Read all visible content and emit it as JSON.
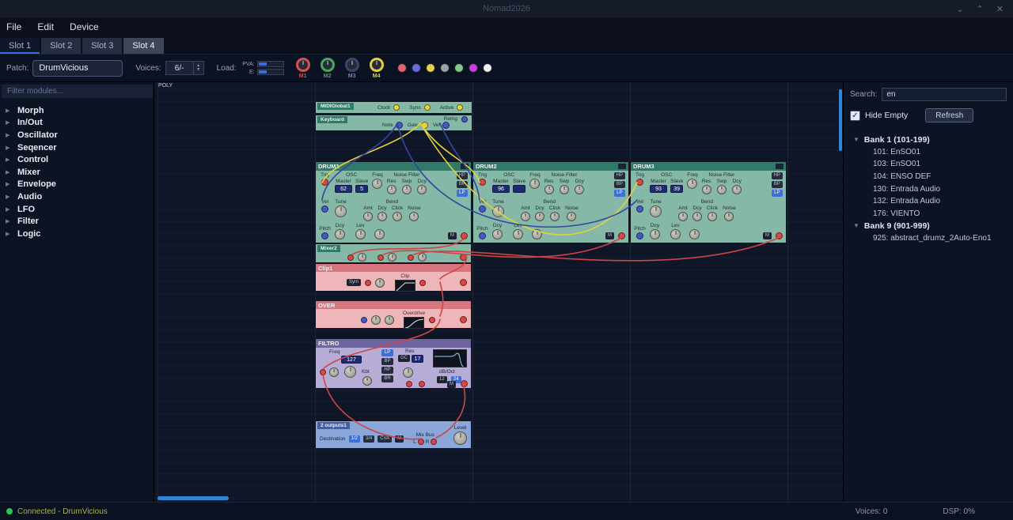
{
  "window": {
    "title": "Nomad2026"
  },
  "menu": {
    "items": [
      "File",
      "Edit",
      "Device"
    ]
  },
  "tabs": {
    "items": [
      "Slot 1",
      "Slot 2",
      "Slot 3",
      "Slot 4"
    ],
    "active": "Slot 4"
  },
  "toolbar": {
    "patch_label": "Patch:",
    "patch_value": "DrumVicious",
    "voices_label": "Voices:",
    "voices_value": "6/-",
    "load_label": "Load:",
    "pva_label": "PVA:",
    "e_label": "E:",
    "morphs": [
      {
        "label": "M1",
        "color": "#d85050"
      },
      {
        "label": "M2",
        "color": "#4aa85c"
      },
      {
        "label": "M3",
        "color": "#3a4670"
      },
      {
        "label": "M4",
        "color": "#e2cf3e"
      }
    ],
    "swatches": [
      "#e0636c",
      "#6a6ade",
      "#e8d04a",
      "#9aa0a8",
      "#7fc98a",
      "#cc3ddd",
      "#f2f2f2"
    ]
  },
  "sidebar": {
    "filter_placeholder": "Filter modules...",
    "items": [
      "Morph",
      "In/Out",
      "Oscillator",
      "Seqencer",
      "Control",
      "Mixer",
      "Envelope",
      "Audio",
      "LFO",
      "Filter",
      "Logic"
    ]
  },
  "canvas": {
    "poly_label": "POLY",
    "midi_global": {
      "name": "MIDIGlobal1",
      "clock": "Clock",
      "sync": "Sync",
      "active": "Active"
    },
    "keyboard": {
      "name": "Keyboard",
      "note": "Note",
      "gate": "Gate",
      "vel": "Vel",
      "retrig": "Retrig"
    },
    "drum_labels": {
      "trig": "Trig",
      "osc": "OSC",
      "master": "Master",
      "slave": "Slave",
      "freq": "Freq",
      "noise_filter": "Noise Filter",
      "res": "Res",
      "swp": "Swp",
      "dcy": "Dcy",
      "vel": "Vel",
      "tune": "Tune",
      "bend": "Bend",
      "amt": "Amt",
      "click": "Click",
      "noise": "Noise",
      "pitch": "Pitch",
      "lev": "Lev",
      "hp": "HP",
      "bp": "BP",
      "lp": "LP",
      "mute": "M"
    },
    "drums": [
      {
        "name": "DRUM1",
        "master_value": "62",
        "slave_value": "5"
      },
      {
        "name": "DRUM2",
        "master_value": "96",
        "slave_value": ""
      },
      {
        "name": "DRUM3",
        "master_value": "93",
        "slave_value": "39"
      }
    ],
    "mixer": {
      "name": "Mixer2"
    },
    "clip": {
      "name": "Clip1",
      "sym_label": "Sym",
      "clip_label": "Clip"
    },
    "over": {
      "name": "OVER",
      "overdrive_label": "Overdrive"
    },
    "filter": {
      "name": "FILTRO",
      "freq_label": "Freq",
      "freq_value": "127",
      "res_label": "Res",
      "gc_label": "GC",
      "res_value": "17",
      "kbt_label": "Kbt",
      "db_oct_label": "dB/Oct",
      "slope_12": "12",
      "slope_24": "24",
      "lp": "LP",
      "bp": "BP",
      "hp": "HP",
      "br": "BR",
      "mute": "M"
    },
    "output": {
      "name": "2 outputs1",
      "destination_label": "Destination",
      "buttons": [
        "1/2",
        "3/4",
        "CVA",
        "M"
      ],
      "mix_bus_label": "Mix Bus",
      "l_label": "L",
      "r_label": "R",
      "level_label": "Level"
    }
  },
  "patch_browser": {
    "search_label": "Search:",
    "search_value": "en",
    "hide_empty_label": "Hide Empty",
    "refresh_label": "Refresh",
    "banks": [
      {
        "label": "Bank 1 (101-199)",
        "entries": [
          "101: EnSO01",
          "103: EnSO01",
          "104: ENSO DEF",
          "130: Entrada Audio",
          "132: Entrada Audio",
          "176: VIENTO"
        ]
      },
      {
        "label": "Bank 9 (901-999)",
        "entries": [
          "925: abstract_drumz_2Auto-Eno1"
        ]
      }
    ]
  },
  "statusbar": {
    "connection": "Connected - DrumVicious",
    "voices": "Voices: 0",
    "dsp": "DSP: 0%"
  },
  "colors": {
    "cable_yellow": "#e6d23e",
    "cable_blue": "#3347a0",
    "cable_red": "#cf4545",
    "accent_blue": "#2f6fe4"
  }
}
